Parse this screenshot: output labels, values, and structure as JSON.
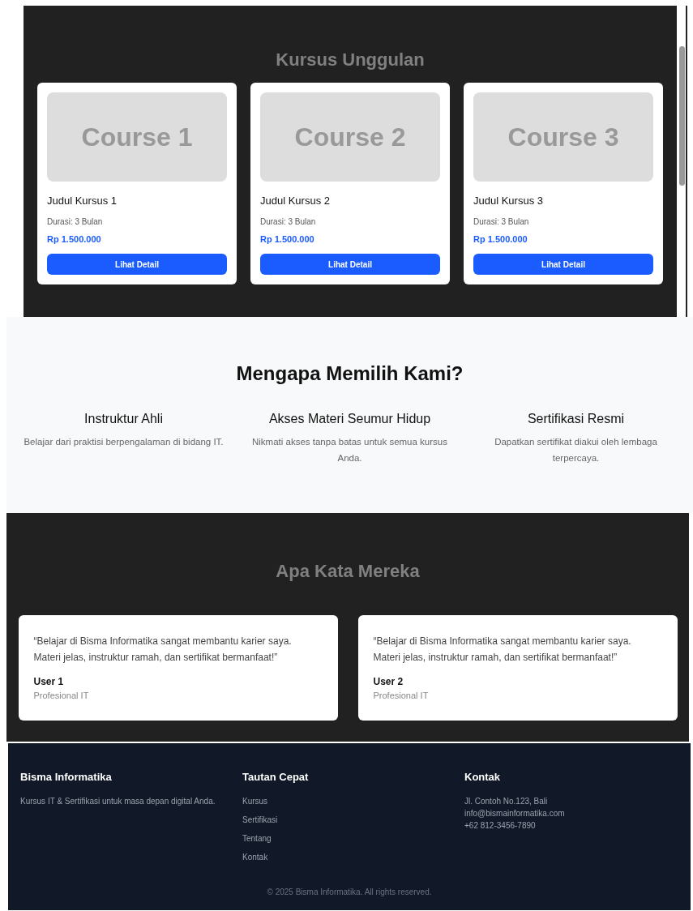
{
  "courses_section": {
    "title": "Kursus Unggulan",
    "courses": [
      {
        "image_label": "Course 1",
        "title": "Judul Kursus 1",
        "duration": "Durasi: 3 Bulan",
        "price": "Rp 1.500.000",
        "button": "Lihat Detail"
      },
      {
        "image_label": "Course 2",
        "title": "Judul Kursus 2",
        "duration": "Durasi: 3 Bulan",
        "price": "Rp 1.500.000",
        "button": "Lihat Detail"
      },
      {
        "image_label": "Course 3",
        "title": "Judul Kursus 3",
        "duration": "Durasi: 3 Bulan",
        "price": "Rp 1.500.000",
        "button": "Lihat Detail"
      }
    ]
  },
  "features_section": {
    "title": "Mengapa Memilih Kami?",
    "features": [
      {
        "title": "Instruktur Ahli",
        "text": "Belajar dari praktisi berpengalaman di bidang IT."
      },
      {
        "title": "Akses Materi Seumur Hidup",
        "text": "Nikmati akses tanpa batas untuk semua kursus Anda."
      },
      {
        "title": "Sertifikasi Resmi",
        "text": "Dapatkan sertifikat diakui oleh lembaga terpercaya."
      }
    ]
  },
  "testimonials_section": {
    "title": "Apa Kata Mereka",
    "testimonials": [
      {
        "quote": "“Belajar di Bisma Informatika sangat membantu karier saya. Materi jelas, instruktur ramah, dan sertifikat bermanfaat!”",
        "name": "User 1",
        "role": "Profesional IT"
      },
      {
        "quote": "“Belajar di Bisma Informatika sangat membantu karier saya. Materi jelas, instruktur ramah, dan sertifikat bermanfaat!”",
        "name": "User 2",
        "role": "Profesional IT"
      }
    ]
  },
  "footer": {
    "brand": {
      "title": "Bisma Informatika",
      "text": "Kursus IT & Sertifikasi untuk masa depan digital Anda."
    },
    "links": {
      "title": "Tautan Cepat",
      "items": [
        "Kursus",
        "Sertifikasi",
        "Tentang",
        "Kontak"
      ]
    },
    "contact": {
      "title": "Kontak",
      "lines": [
        "Jl. Contoh No.123, Bali",
        "info@bismainformatika.com",
        "+62 812-3456-7890"
      ]
    },
    "copyright": "© 2025 Bisma Informatika. All rights reserved."
  }
}
